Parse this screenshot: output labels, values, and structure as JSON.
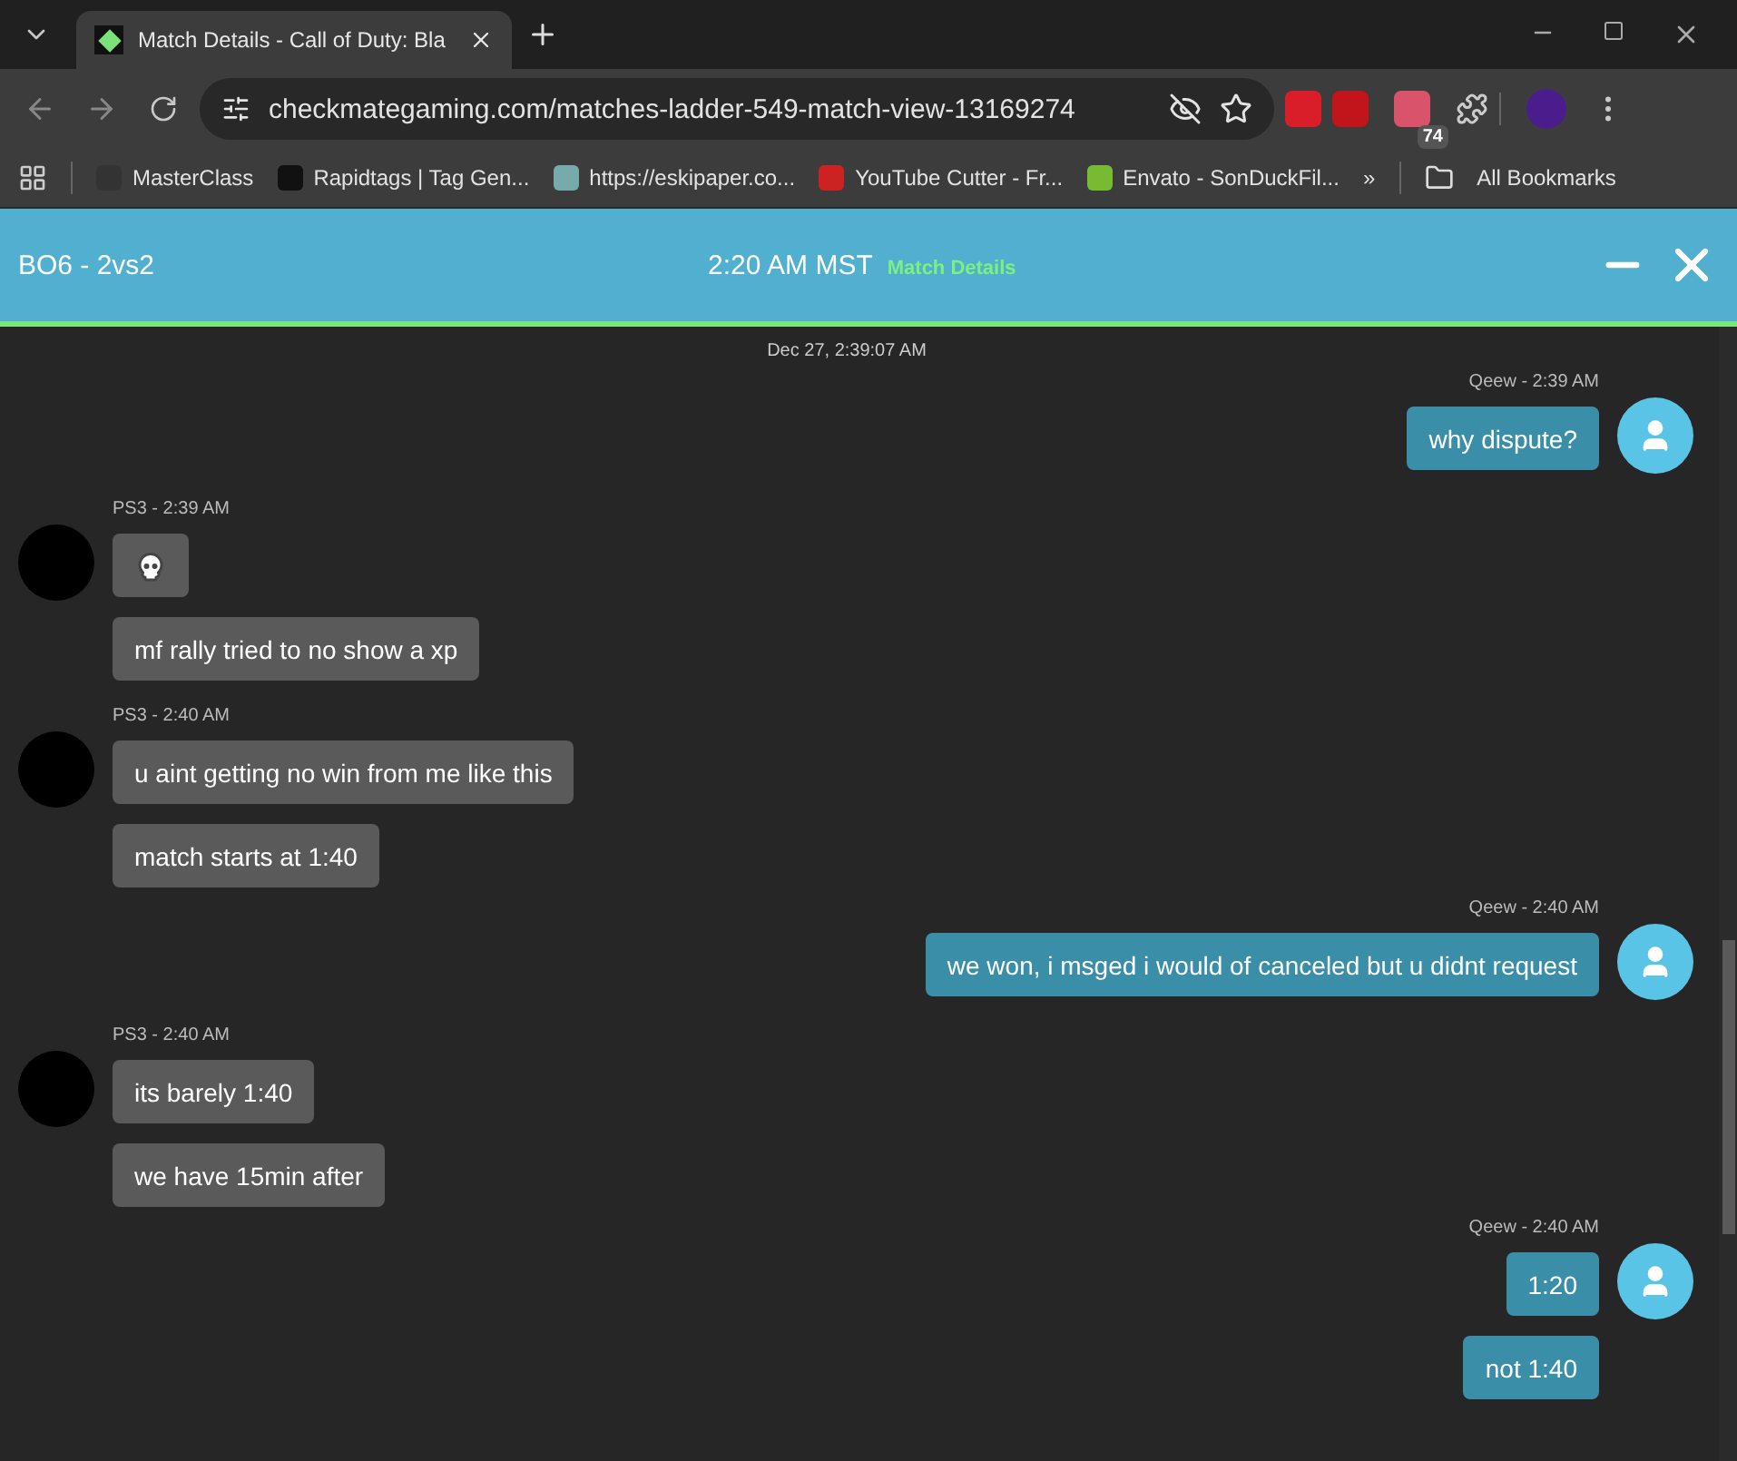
{
  "browser": {
    "tab": {
      "title": "Match Details - Call of Duty: Bla",
      "selected": true
    },
    "url": "checkmategaming.com/matches-ladder-549-match-view-13169274",
    "extension_badge": "74",
    "bookmarks": [
      {
        "label": "MasterClass"
      },
      {
        "label": "Rapidtags | Tag Gen..."
      },
      {
        "label": "https://eskipaper.co..."
      },
      {
        "label": "YouTube Cutter - Fr..."
      },
      {
        "label": "Envato - SonDuckFil..."
      }
    ],
    "more": "»",
    "all_bookmarks": "All Bookmarks"
  },
  "header": {
    "title": "BO6 - 2vs2",
    "time": "2:20 AM MST",
    "link": "Match Details"
  },
  "chat": {
    "date": "Dec 27, 2:39:07 AM",
    "groups": [
      {
        "own": true,
        "meta": "Qeew - 2:39 AM",
        "messages": [
          {
            "kind": "text",
            "text": "why dispute?"
          }
        ]
      },
      {
        "own": false,
        "meta": "PS3 - 2:39 AM",
        "messages": [
          {
            "kind": "emoji"
          },
          {
            "kind": "text",
            "text": "mf rally tried to no show a xp"
          }
        ]
      },
      {
        "own": false,
        "meta": "PS3 - 2:40 AM",
        "messages": [
          {
            "kind": "text",
            "text": "u aint getting no win from me like this"
          },
          {
            "kind": "text",
            "text": "match starts at 1:40"
          }
        ]
      },
      {
        "own": true,
        "meta": "Qeew - 2:40 AM",
        "messages": [
          {
            "kind": "text",
            "text": "we won, i msged i would of canceled but u didnt request"
          }
        ]
      },
      {
        "own": false,
        "meta": "PS3 - 2:40 AM",
        "messages": [
          {
            "kind": "text",
            "text": "its barely 1:40"
          },
          {
            "kind": "text",
            "text": "we have 15min after"
          }
        ]
      },
      {
        "own": true,
        "meta": "Qeew - 2:40 AM",
        "messages": [
          {
            "kind": "text",
            "text": "1:20"
          },
          {
            "kind": "text",
            "text": "not 1:40"
          }
        ]
      }
    ]
  }
}
